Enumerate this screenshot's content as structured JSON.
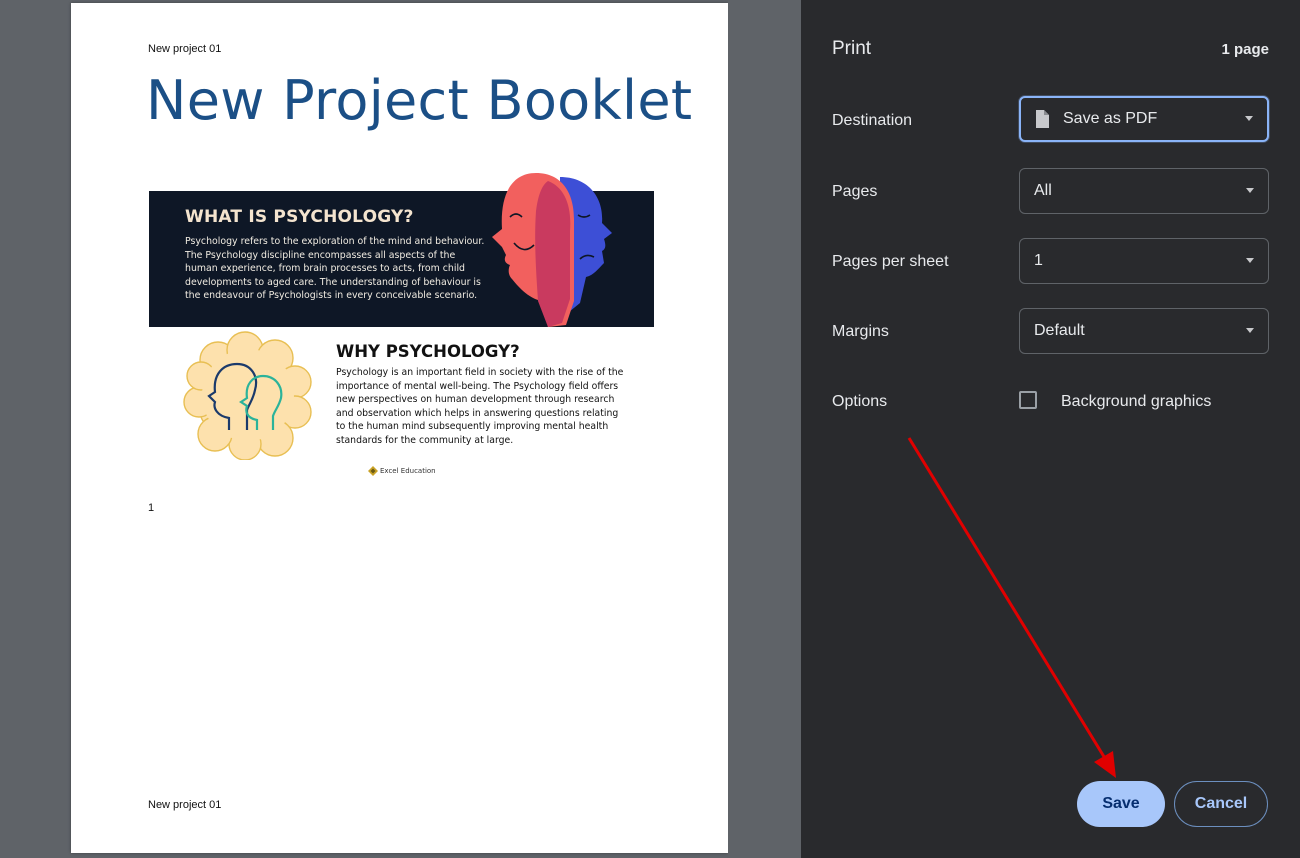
{
  "document": {
    "header_text": "New project 01",
    "footer_text": "New project 01",
    "title": "New Project Booklet",
    "section1": {
      "heading": "WHAT IS PSYCHOLOGY?",
      "body": "Psychology refers to the exploration of the mind and behaviour. The Psychology discipline encompasses all aspects of the human experience, from brain processes to acts, from child developments to aged care. The understanding of behaviour is the endeavour of Psychologists in every conceivable scenario."
    },
    "section2": {
      "heading": "WHY PSYCHOLOGY?",
      "body": "Psychology is an important field in society with the rise of the importance of mental well-being. The Psychology field offers new perspectives on human development through research and observation which helps in answering questions relating to the human mind subsequently improving mental health standards for the community at large."
    },
    "logo_text": "Excel Education",
    "page_number": "1"
  },
  "panel": {
    "title": "Print",
    "page_count": "1 page",
    "destination": {
      "label": "Destination",
      "value": "Save as PDF",
      "icon": "file-icon"
    },
    "pages": {
      "label": "Pages",
      "value": "All"
    },
    "pages_per_sheet": {
      "label": "Pages per sheet",
      "value": "1"
    },
    "margins": {
      "label": "Margins",
      "value": "Default"
    },
    "options": {
      "label": "Options",
      "checkbox_label": "Background graphics",
      "checked": false
    },
    "save_label": "Save",
    "cancel_label": "Cancel"
  },
  "colors": {
    "panel_bg": "#292a2d",
    "preview_bg": "#5f6368",
    "accent": "#a8c7fa",
    "title_blue": "#1b4f86",
    "annotation_arrow": "#e00000"
  }
}
